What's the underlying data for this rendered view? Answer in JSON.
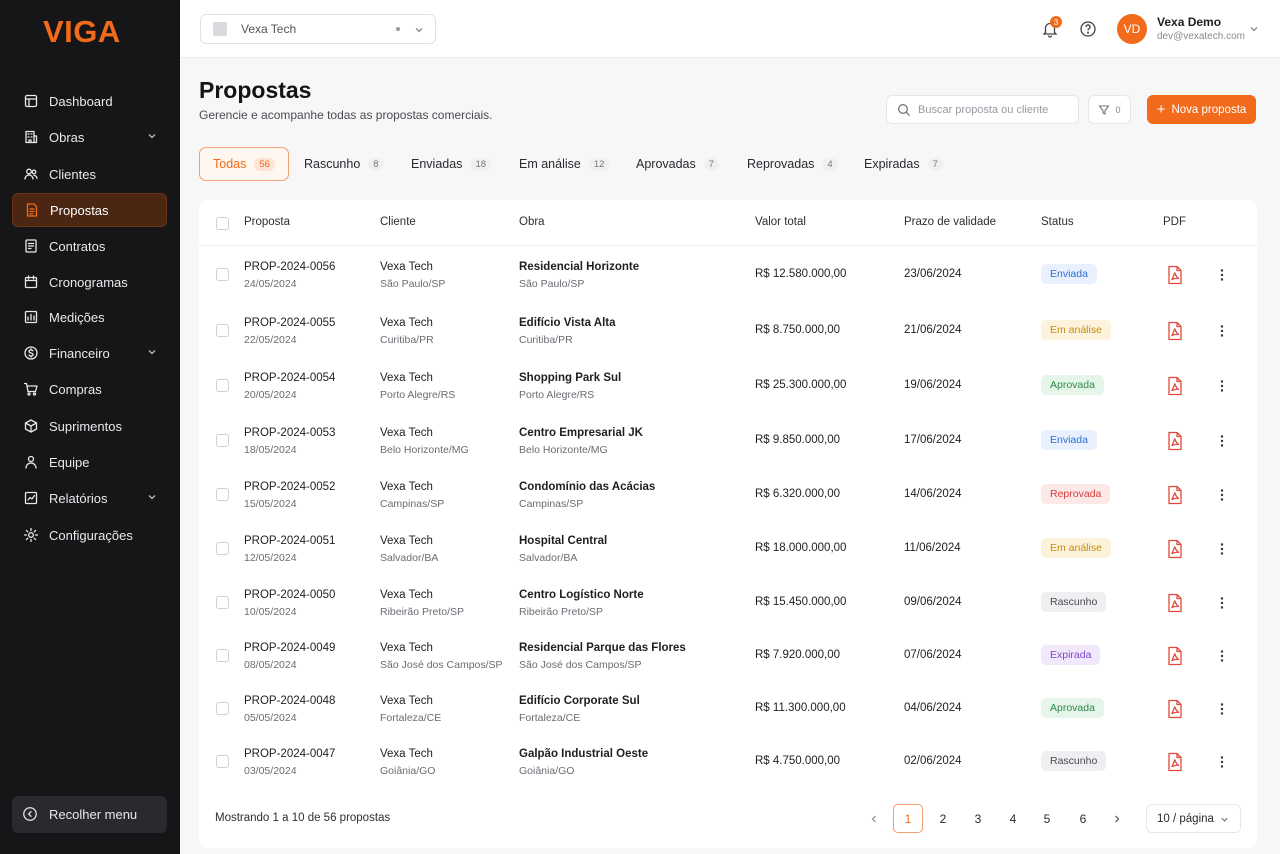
{
  "brand": {
    "logo_text": "VIGA",
    "accent": "#f26a1b"
  },
  "sidebar": {
    "items": [
      {
        "label": "Dashboard",
        "icon": "dashboard-icon",
        "has_chevron": false,
        "active": false
      },
      {
        "label": "Obras",
        "icon": "building-icon",
        "has_chevron": true,
        "active": false
      },
      {
        "label": "Clientes",
        "icon": "users-icon",
        "has_chevron": false,
        "active": false
      },
      {
        "label": "Propostas",
        "icon": "document-icon",
        "has_chevron": false,
        "active": true
      },
      {
        "label": "Contratos",
        "icon": "contract-icon",
        "has_chevron": false,
        "active": false
      },
      {
        "label": "Cronogramas",
        "icon": "calendar-icon",
        "has_chevron": false,
        "active": false
      },
      {
        "label": "Medições",
        "icon": "measure-icon",
        "has_chevron": false,
        "active": false
      },
      {
        "label": "Financeiro",
        "icon": "dollar-icon",
        "has_chevron": true,
        "active": false
      },
      {
        "label": "Compras",
        "icon": "cart-icon",
        "has_chevron": false,
        "active": false
      },
      {
        "label": "Suprimentos",
        "icon": "supplies-icon",
        "has_chevron": false,
        "active": false
      },
      {
        "label": "Equipe",
        "icon": "team-icon",
        "has_chevron": false,
        "active": false
      },
      {
        "label": "Relatórios",
        "icon": "reports-icon",
        "has_chevron": true,
        "active": false
      },
      {
        "label": "Configurações",
        "icon": "gear-icon",
        "has_chevron": false,
        "active": false
      }
    ],
    "collapse_label": "Recolher menu"
  },
  "topbar": {
    "company": "Vexa Tech",
    "notifications_count": "3",
    "user": {
      "initials": "VD",
      "name": "Vexa Demo",
      "email": "dev@vexatech.com"
    }
  },
  "header": {
    "title": "Propostas",
    "subtitle": "Gerencie e acompanhe todas as propostas comerciais.",
    "search_placeholder": "Buscar proposta ou cliente",
    "filter_count": "0",
    "new_button": "Nova proposta"
  },
  "tabs": [
    {
      "label": "Todas",
      "count": "56",
      "active": true
    },
    {
      "label": "Rascunho",
      "count": "8",
      "active": false
    },
    {
      "label": "Enviadas",
      "count": "18",
      "active": false
    },
    {
      "label": "Em análise",
      "count": "12",
      "active": false
    },
    {
      "label": "Aprovadas",
      "count": "7",
      "active": false
    },
    {
      "label": "Reprovadas",
      "count": "4",
      "active": false
    },
    {
      "label": "Expiradas",
      "count": "7",
      "active": false
    }
  ],
  "table": {
    "columns": [
      "Proposta",
      "Cliente",
      "Obra",
      "Valor total",
      "Prazo de validade",
      "Status",
      "PDF"
    ],
    "status_colors": {
      "Enviada": {
        "bg": "#e8f1fd",
        "fg": "#2f6fd6"
      },
      "Em análise": {
        "bg": "#fdf3dc",
        "fg": "#c98a0c"
      },
      "Aprovada": {
        "bg": "#e6f5ea",
        "fg": "#2e8a45"
      },
      "Reprovada": {
        "bg": "#fde8e8",
        "fg": "#d33d3d"
      },
      "Rascunho": {
        "bg": "#efeff1",
        "fg": "#4a4a52"
      },
      "Expirada": {
        "bg": "#f1e9fb",
        "fg": "#7e45c9"
      }
    },
    "rows": [
      {
        "id": "PROP-2024-0056",
        "date": "24/05/2024",
        "client": "Vexa Tech",
        "client_city": "São Paulo/SP",
        "work": "Residencial Horizonte",
        "work_city": "São Paulo/SP",
        "value": "R$ 12.580.000,00",
        "validity": "23/06/2024",
        "status": "Enviada"
      },
      {
        "id": "PROP-2024-0055",
        "date": "22/05/2024",
        "client": "Vexa Tech",
        "client_city": "Curitiba/PR",
        "work": "Edifício Vista Alta",
        "work_city": "Curitiba/PR",
        "value": "R$ 8.750.000,00",
        "validity": "21/06/2024",
        "status": "Em análise"
      },
      {
        "id": "PROP-2024-0054",
        "date": "20/05/2024",
        "client": "Vexa Tech",
        "client_city": "Porto Alegre/RS",
        "work": "Shopping Park Sul",
        "work_city": "Porto Alegre/RS",
        "value": "R$ 25.300.000,00",
        "validity": "19/06/2024",
        "status": "Aprovada"
      },
      {
        "id": "PROP-2024-0053",
        "date": "18/05/2024",
        "client": "Vexa Tech",
        "client_city": "Belo Horizonte/MG",
        "work": "Centro Empresarial JK",
        "work_city": "Belo Horizonte/MG",
        "value": "R$ 9.850.000,00",
        "validity": "17/06/2024",
        "status": "Enviada"
      },
      {
        "id": "PROP-2024-0052",
        "date": "15/05/2024",
        "client": "Vexa Tech",
        "client_city": "Campinas/SP",
        "work": "Condomínio das Acácias",
        "work_city": "Campinas/SP",
        "value": "R$ 6.320.000,00",
        "validity": "14/06/2024",
        "status": "Reprovada"
      },
      {
        "id": "PROP-2024-0051",
        "date": "12/05/2024",
        "client": "Vexa Tech",
        "client_city": "Salvador/BA",
        "work": "Hospital Central",
        "work_city": "Salvador/BA",
        "value": "R$ 18.000.000,00",
        "validity": "11/06/2024",
        "status": "Em análise"
      },
      {
        "id": "PROP-2024-0050",
        "date": "10/05/2024",
        "client": "Vexa Tech",
        "client_city": "Ribeirão Preto/SP",
        "work": "Centro Logístico Norte",
        "work_city": "Ribeirão Preto/SP",
        "value": "R$ 15.450.000,00",
        "validity": "09/06/2024",
        "status": "Rascunho"
      },
      {
        "id": "PROP-2024-0049",
        "date": "08/05/2024",
        "client": "Vexa Tech",
        "client_city": "São José dos Campos/SP",
        "work": "Residencial Parque das Flores",
        "work_city": "São José dos Campos/SP",
        "value": "R$ 7.920.000,00",
        "validity": "07/06/2024",
        "status": "Expirada"
      },
      {
        "id": "PROP-2024-0048",
        "date": "05/05/2024",
        "client": "Vexa Tech",
        "client_city": "Fortaleza/CE",
        "work": "Edifício Corporate Sul",
        "work_city": "Fortaleza/CE",
        "value": "R$ 11.300.000,00",
        "validity": "04/06/2024",
        "status": "Aprovada"
      },
      {
        "id": "PROP-2024-0047",
        "date": "03/05/2024",
        "client": "Vexa Tech",
        "client_city": "Goiânia/GO",
        "work": "Galpão Industrial Oeste",
        "work_city": "Goiânia/GO",
        "value": "R$ 4.750.000,00",
        "validity": "02/06/2024",
        "status": "Rascunho"
      }
    ]
  },
  "pagination": {
    "summary": "Mostrando 1 a 10 de 56 propostas",
    "pages": [
      "1",
      "2",
      "3",
      "4",
      "5",
      "6"
    ],
    "current": "1",
    "per_page": "10 / página"
  }
}
